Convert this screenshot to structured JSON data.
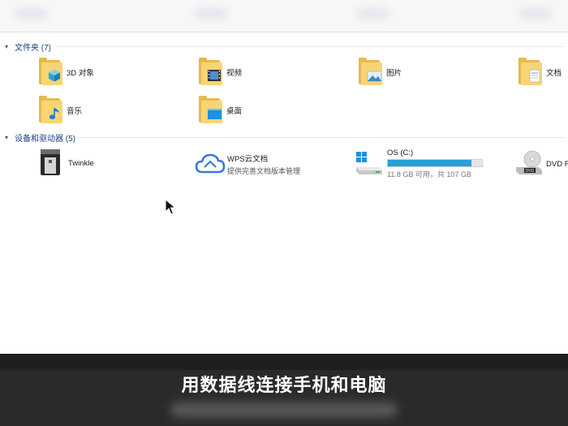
{
  "sections": {
    "folders": {
      "title": "文件夹 (7)"
    },
    "devices": {
      "title": "设备和驱动器 (5)"
    }
  },
  "folders": [
    {
      "name": "3D 对象",
      "badge": "cube-icon"
    },
    {
      "name": "视频",
      "badge": "film-icon"
    },
    {
      "name": "图片",
      "badge": "picture-icon"
    },
    {
      "name": "文档",
      "badge": "document-icon"
    },
    {
      "name": "音乐",
      "badge": "music-note-icon"
    },
    {
      "name": "桌面",
      "badge": "desktop-icon"
    }
  ],
  "devices": {
    "twinkle": {
      "name": "Twinkle"
    },
    "wps": {
      "name": "WPS云文档",
      "desc": "提供完善文档版本管理"
    },
    "os": {
      "name": "OS (C:)",
      "free": "11.8 GB 可用，共 107 GB",
      "used_fraction": 0.89
    },
    "dvd": {
      "name": "DVD R"
    }
  },
  "caption": "用数据线连接手机和电脑",
  "colors": {
    "accent": "#26a0da",
    "folder": "#f7d574",
    "section": "#1e3f8a",
    "caption_bg": "#2a2a2a"
  }
}
